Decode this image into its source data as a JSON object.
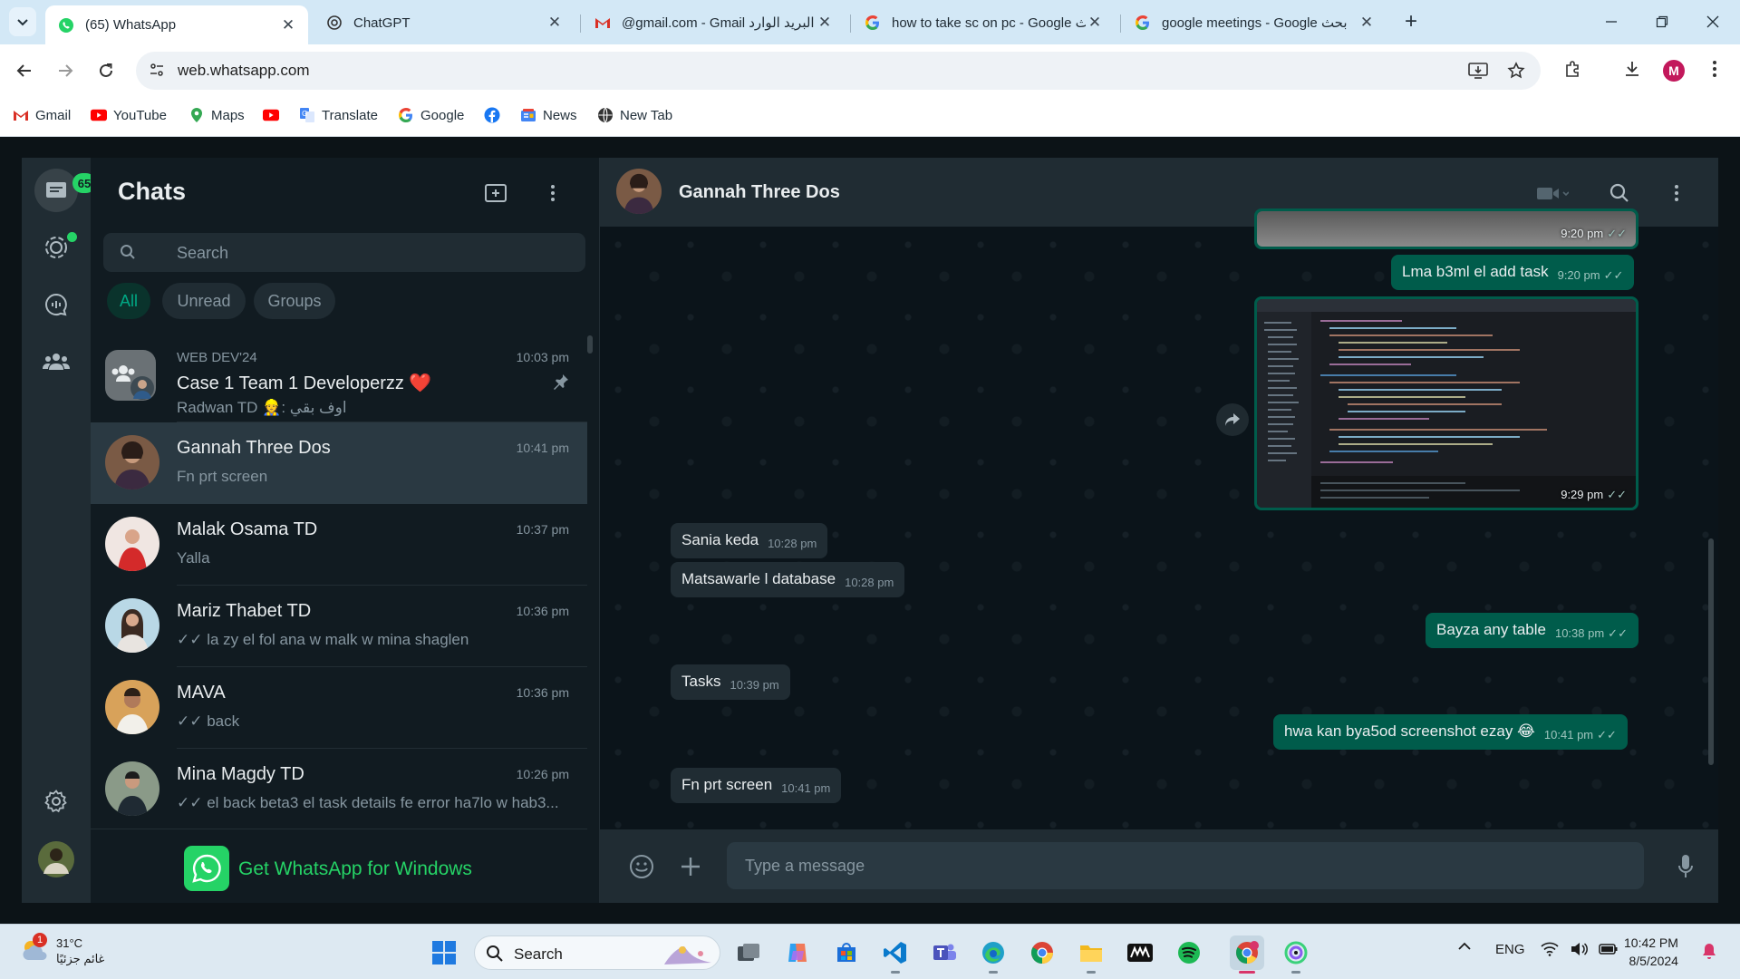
{
  "browser": {
    "tabs": [
      {
        "title": "(65) WhatsApp",
        "favicon": "whatsapp-icon",
        "active": true
      },
      {
        "title": "ChatGPT",
        "favicon": "chatgpt-icon"
      },
      {
        "title": "@gmail.com - Gmail البريد الوارد",
        "favicon": "gmail-icon"
      },
      {
        "title": "how to take sc on pc - Google بحث",
        "favicon": "google-icon"
      },
      {
        "title": "google meetings - Google بحث",
        "favicon": "google-icon"
      }
    ],
    "url": "web.whatsapp.com",
    "profile_initial": "M",
    "bookmarks": [
      "Gmail",
      "YouTube",
      "Maps",
      "",
      "Translate",
      "Google",
      "",
      "News",
      "New Tab"
    ]
  },
  "sidebar": {
    "badge_count": "65"
  },
  "chatlist": {
    "title": "Chats",
    "search_placeholder": "Search",
    "filters": [
      "All",
      "Unread",
      "Groups"
    ],
    "chats": [
      {
        "group_label": "WEB DEV'24",
        "name": "Case 1 Team 1 Developerzz ❤️",
        "time": "10:03 pm",
        "preview": "Radwan TD 👷: اوف بقي",
        "pinned": true
      },
      {
        "name": "Gannah Three Dos",
        "time": "10:41 pm",
        "preview": "Fn prt screen",
        "selected": true
      },
      {
        "name": "Malak Osama TD",
        "time": "10:37 pm",
        "preview": "Yalla"
      },
      {
        "name": "Mariz Thabet TD",
        "time": "10:36 pm",
        "preview": "✓✓ la zy el fol ana w malk w mina shaglen"
      },
      {
        "name": "MAVA",
        "time": "10:36 pm",
        "preview": "✓✓ back"
      },
      {
        "name": "Mina  Magdy TD",
        "time": "10:26 pm",
        "preview": "✓✓ el back beta3 el task details fe error ha7lo w hab3..."
      }
    ],
    "promo": "Get WhatsApp for Windows"
  },
  "conversation": {
    "contact_name": "Gannah Three Dos",
    "messages": [
      {
        "dir": "out",
        "kind": "image",
        "time": "9:20 pm"
      },
      {
        "dir": "out",
        "text": "Lma b3ml el add task",
        "time": "9:20 pm"
      },
      {
        "dir": "out",
        "kind": "image",
        "time": "9:29 pm"
      },
      {
        "dir": "in",
        "text": "Sania keda",
        "time": "10:28 pm"
      },
      {
        "dir": "in",
        "text": "Matsawarle l database",
        "time": "10:28 pm"
      },
      {
        "dir": "out",
        "text": "Bayza any table",
        "time": "10:38 pm"
      },
      {
        "dir": "in",
        "text": "Tasks",
        "time": "10:39 pm"
      },
      {
        "dir": "out",
        "text": "hwa kan bya5od screenshot ezay 😂",
        "time": "10:41 pm"
      },
      {
        "dir": "in",
        "text": "Fn prt screen",
        "time": "10:41 pm"
      }
    ],
    "input_placeholder": "Type a message"
  },
  "taskbar": {
    "weather_temp": "31°C",
    "weather_desc": "غائم جزئيًا",
    "weather_badge": "1",
    "search_label": "Search",
    "language": "ENG",
    "time": "10:42 PM",
    "date": "8/5/2024"
  },
  "colors": {
    "wa_green": "#25d366",
    "wa_teal": "#00a884",
    "outgoing_bubble": "#005c4b",
    "incoming_bubble": "#202c33",
    "panel_bg": "#111b21"
  }
}
